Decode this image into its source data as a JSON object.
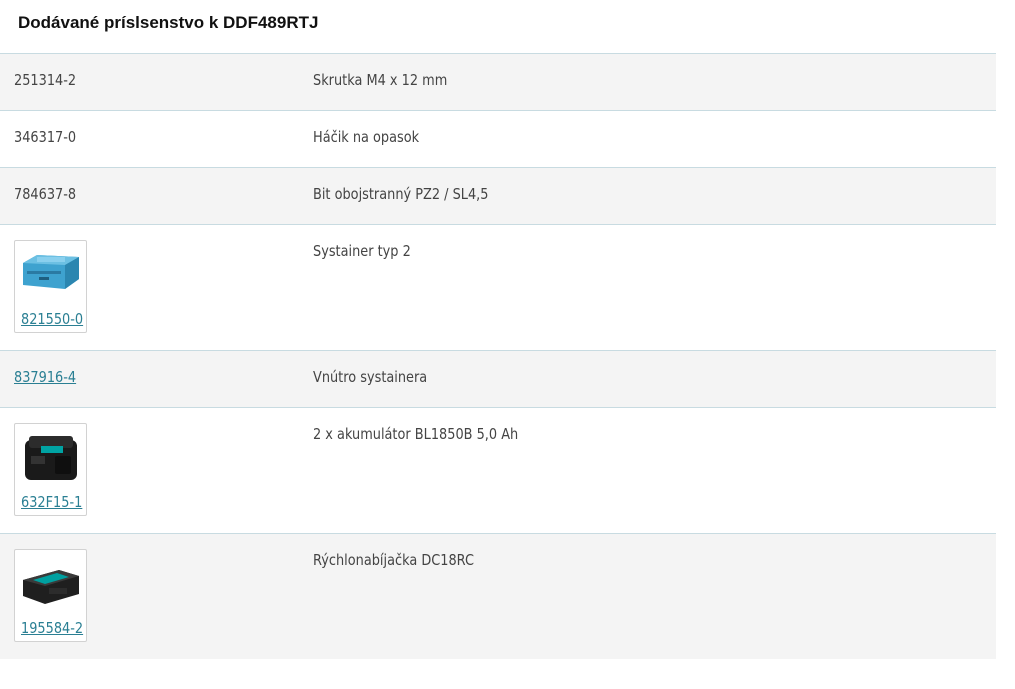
{
  "heading": "Dodávané príslsenstvo k DDF489RTJ",
  "rows": [
    {
      "code": "251314-2",
      "desc": "Skrutka M4 x 12 mm",
      "link": false,
      "icon": null
    },
    {
      "code": "346317-0",
      "desc": "Háčik na opasok",
      "link": false,
      "icon": null
    },
    {
      "code": "784637-8",
      "desc": "Bit obojstranný PZ2 / SL4,5",
      "link": false,
      "icon": null
    },
    {
      "code": "821550-0",
      "desc": "Systainer typ 2",
      "link": true,
      "icon": "systainer-case-icon"
    },
    {
      "code": "837916-4",
      "desc": "Vnútro systainera",
      "link": true,
      "icon": null
    },
    {
      "code": "632F15-1",
      "desc": "2 x akumulátor BL1850B 5,0 Ah",
      "link": true,
      "icon": "battery-icon"
    },
    {
      "code": "195584-2",
      "desc": "Rýchlonabíjačka DC18RC",
      "link": true,
      "icon": "charger-icon"
    }
  ],
  "colors": {
    "link": "#2a7f93",
    "row_alt": "#f4f4f4",
    "border": "#c8dbe1",
    "case_blue": "#3ea2cf"
  }
}
